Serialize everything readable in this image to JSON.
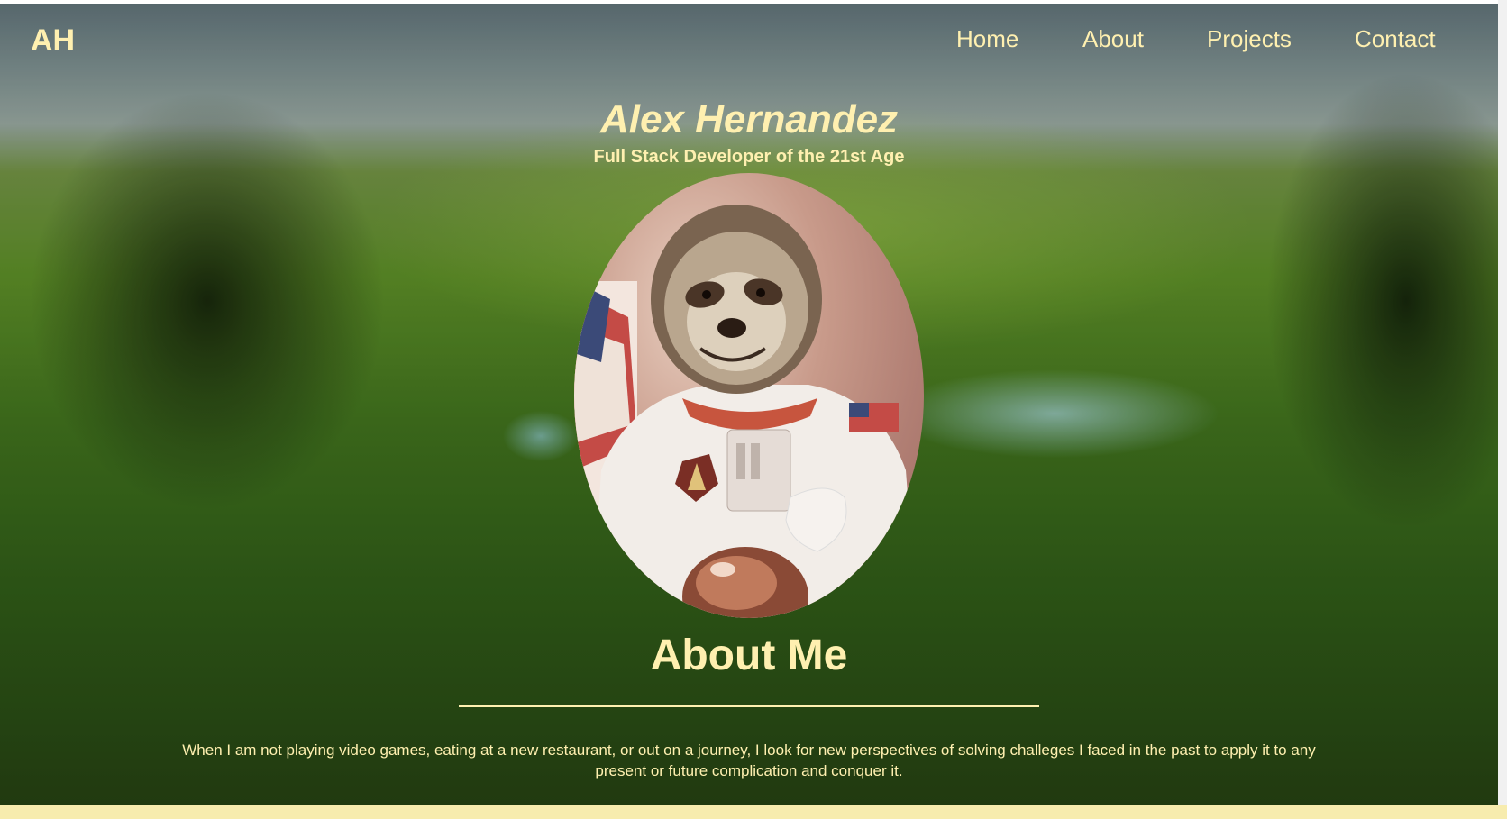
{
  "header": {
    "logo": "AH",
    "nav": [
      "Home",
      "About",
      "Projects",
      "Contact"
    ]
  },
  "hero": {
    "name": "Alex Hernandez",
    "tagline": "Full Stack Developer of the 21st Age"
  },
  "about": {
    "heading": "About Me",
    "text": "When I am not playing video games, eating at a new restaurant, or out on a journey, I look for new perspectives of solving challeges I faced in the past to apply it to any present or future complication and conquer it."
  },
  "colors": {
    "text_accent": "#fff0b0",
    "footer_strip": "#f7ecae"
  },
  "icons": {
    "portrait": "astronaut-sloth-photo"
  }
}
